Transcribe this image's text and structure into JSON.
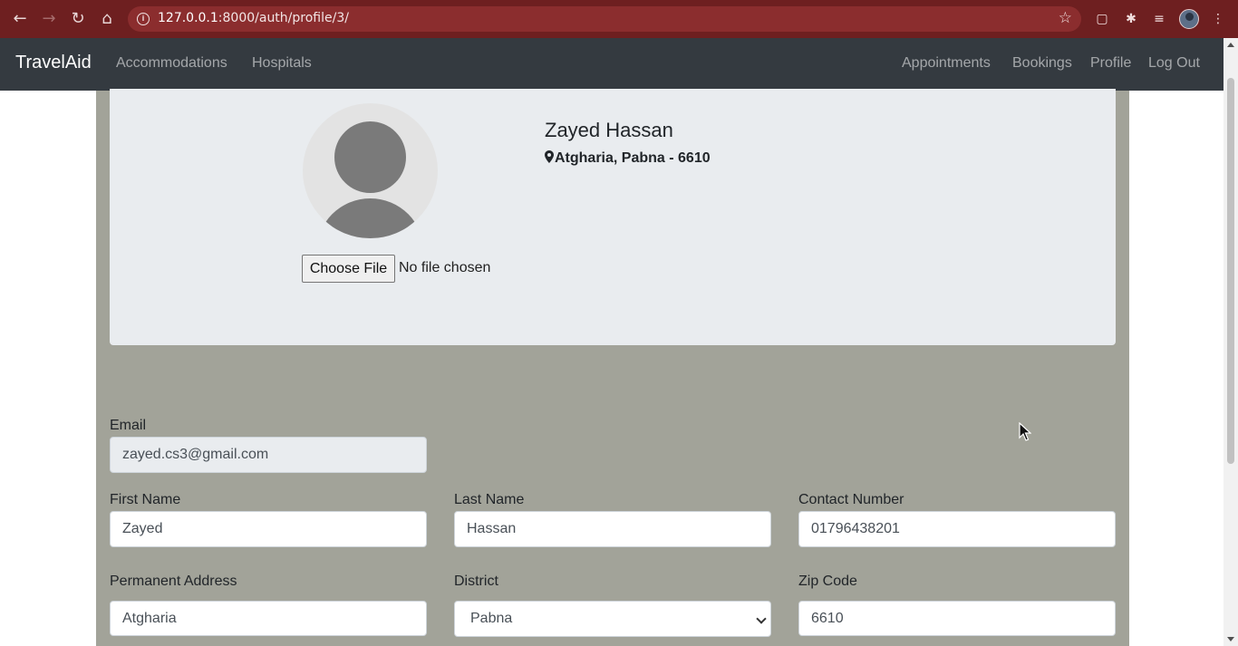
{
  "browser": {
    "url_prefix": "127.0.0.1",
    "url_rest": ":8000/auth/profile/3/"
  },
  "navbar": {
    "brand": "TravelAid",
    "left_links": [
      "Accommodations",
      "Hospitals"
    ],
    "right_links": [
      "Appointments",
      "Bookings",
      "Profile",
      "Log Out"
    ]
  },
  "profile": {
    "name": "Zayed Hassan",
    "location": "Atgharia, Pabna - 6610",
    "file_button": "Choose File",
    "file_status": "No file chosen"
  },
  "form": {
    "email_label": "Email",
    "email_value": "zayed.cs3@gmail.com",
    "first_name_label": "First Name",
    "first_name_value": "Zayed",
    "last_name_label": "Last Name",
    "last_name_value": "Hassan",
    "contact_label": "Contact Number",
    "contact_value": "01796438201",
    "address_label": "Permanent Address",
    "address_value": "Atgharia",
    "district_label": "District",
    "district_value": "Pabna",
    "zip_label": "Zip Code",
    "zip_value": "6610"
  },
  "colors": {
    "chrome": "#6e1f20",
    "navbar": "#343a40",
    "container": "#a2a399",
    "card": "#e9ecef"
  }
}
